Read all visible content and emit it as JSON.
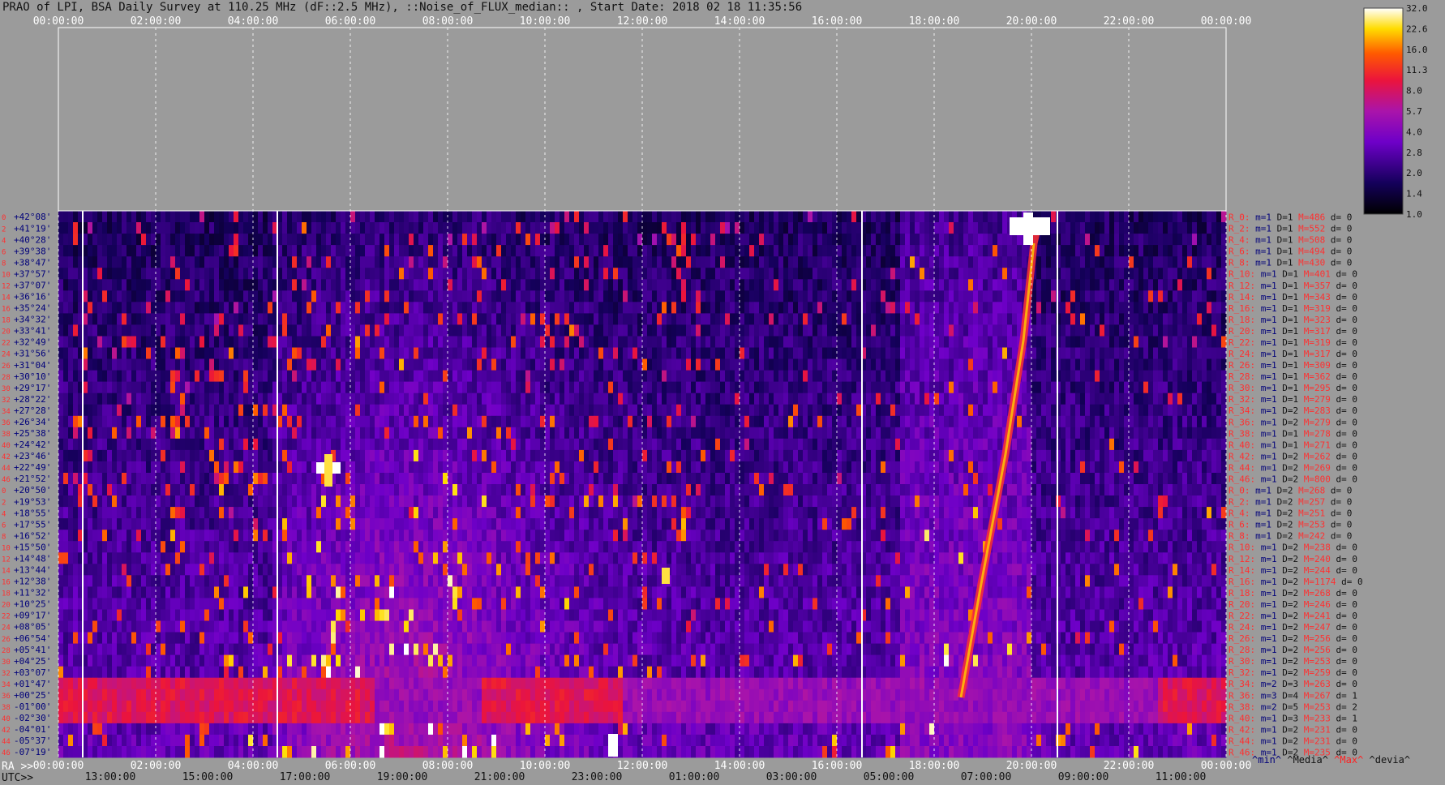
{
  "title": "PRAO of LPI, BSA Daily Survey at 110.25 MHz (dF::2.5 MHz), ::Noise_of_FLUX_median:: , Start Date: 2018 02 18 11:35:56",
  "axis_labels": {
    "ra": "RA >>",
    "utc": "UTC>>"
  },
  "legend_bottom": {
    "min": "^min^",
    "median": "^Media^",
    "max": "^Max^",
    "devia": "^devia^"
  },
  "colors": {
    "background": "#9b9b9b",
    "min": "#00007a",
    "median": "#111111",
    "max": "#ff2020",
    "devia": "#111111"
  },
  "chart_data": {
    "type": "heatmap",
    "colormap": "gnuplot-like (black-purple-red-yellow-white)",
    "top_time_ticks": [
      "00:00:00",
      "02:00:00",
      "04:00:00",
      "06:00:00",
      "08:00:00",
      "10:00:00",
      "12:00:00",
      "14:00:00",
      "16:00:00",
      "18:00:00",
      "20:00:00",
      "22:00:00",
      "00:00:00"
    ],
    "ra_ticks": [
      "00:00:00",
      "02:00:00",
      "04:00:00",
      "06:00:00",
      "08:00:00",
      "10:00:00",
      "12:00:00",
      "14:00:00",
      "16:00:00",
      "18:00:00",
      "20:00:00",
      "22:00:00",
      "00:00:00"
    ],
    "utc_ticks": [
      "13:00:00",
      "15:00:00",
      "17:00:00",
      "19:00:00",
      "21:00:00",
      "23:00:00",
      "01:00:00",
      "03:00:00",
      "05:00:00",
      "07:00:00",
      "09:00:00",
      "11:00:00"
    ],
    "colorbar_ticks": [
      "32.0",
      "22.6",
      "16.0",
      "11.3",
      "8.0",
      "5.7",
      "4.0",
      "2.8",
      "2.0",
      "1.4",
      "1.0"
    ],
    "declinations": [
      "+42°08'",
      "+41°19'",
      "+40°28'",
      "+39°38'",
      "+38°47'",
      "+37°57'",
      "+37°07'",
      "+36°16'",
      "+35°24'",
      "+34°32'",
      "+33°41'",
      "+32°49'",
      "+31°56'",
      "+31°04'",
      "+30°10'",
      "+29°17'",
      "+28°22'",
      "+27°28'",
      "+26°34'",
      "+25°38'",
      "+24°42'",
      "+23°46'",
      "+22°49'",
      "+21°52'",
      "+20°50'",
      "+19°53'",
      "+18°55'",
      "+17°55'",
      "+16°52'",
      "+15°50'",
      "+14°48'",
      "+13°44'",
      "+12°38'",
      "+11°32'",
      "+10°25'",
      "+09°17'",
      "+08°05'",
      "+06°54'",
      "+05°41'",
      "+04°25'",
      "+03°07'",
      "+01°47'",
      "+00°25'",
      "-01°00'",
      "-02°30'",
      "-04°01'",
      "-05°37'",
      "-07°19'"
    ],
    "row_numbers_left": [
      "0",
      "2",
      "4",
      "6",
      "8",
      "10",
      "12",
      "14",
      "16",
      "18",
      "20",
      "22",
      "24",
      "26",
      "28",
      "30",
      "32",
      "34",
      "36",
      "38",
      "40",
      "42",
      "44",
      "46",
      "0",
      "2",
      "4",
      "6",
      "8",
      "10",
      "12",
      "14",
      "16",
      "18",
      "20",
      "22",
      "24",
      "26",
      "28",
      "30",
      "32",
      "34",
      "36",
      "38",
      "40",
      "42",
      "44",
      "46"
    ],
    "rows": [
      {
        "r": "R_0:",
        "m": "m=1",
        "D": "D=1",
        "M": "M=486",
        "d": "d= 0"
      },
      {
        "r": "R_2:",
        "m": "m=1",
        "D": "D=1",
        "M": "M=552",
        "d": "d= 0"
      },
      {
        "r": "R_4:",
        "m": "m=1",
        "D": "D=1",
        "M": "M=508",
        "d": "d= 0"
      },
      {
        "r": "R_6:",
        "m": "m=1",
        "D": "D=1",
        "M": "M=494",
        "d": "d= 0"
      },
      {
        "r": "R_8:",
        "m": "m=1",
        "D": "D=1",
        "M": "M=430",
        "d": "d= 0"
      },
      {
        "r": "R_10:",
        "m": "m=1",
        "D": "D=1",
        "M": "M=401",
        "d": "d= 0"
      },
      {
        "r": "R_12:",
        "m": "m=1",
        "D": "D=1",
        "M": "M=357",
        "d": "d= 0"
      },
      {
        "r": "R_14:",
        "m": "m=1",
        "D": "D=1",
        "M": "M=343",
        "d": "d= 0"
      },
      {
        "r": "R_16:",
        "m": "m=1",
        "D": "D=1",
        "M": "M=319",
        "d": "d= 0"
      },
      {
        "r": "R_18:",
        "m": "m=1",
        "D": "D=1",
        "M": "M=323",
        "d": "d= 0"
      },
      {
        "r": "R_20:",
        "m": "m=1",
        "D": "D=1",
        "M": "M=317",
        "d": "d= 0"
      },
      {
        "r": "R_22:",
        "m": "m=1",
        "D": "D=1",
        "M": "M=319",
        "d": "d= 0"
      },
      {
        "r": "R_24:",
        "m": "m=1",
        "D": "D=1",
        "M": "M=317",
        "d": "d= 0"
      },
      {
        "r": "R_26:",
        "m": "m=1",
        "D": "D=1",
        "M": "M=309",
        "d": "d= 0"
      },
      {
        "r": "R_28:",
        "m": "m=1",
        "D": "D=1",
        "M": "M=362",
        "d": "d= 0"
      },
      {
        "r": "R_30:",
        "m": "m=1",
        "D": "D=1",
        "M": "M=295",
        "d": "d= 0"
      },
      {
        "r": "R_32:",
        "m": "m=1",
        "D": "D=1",
        "M": "M=279",
        "d": "d= 0"
      },
      {
        "r": "R_34:",
        "m": "m=1",
        "D": "D=2",
        "M": "M=283",
        "d": "d= 0"
      },
      {
        "r": "R_36:",
        "m": "m=1",
        "D": "D=2",
        "M": "M=279",
        "d": "d= 0"
      },
      {
        "r": "R_38:",
        "m": "m=1",
        "D": "D=1",
        "M": "M=278",
        "d": "d= 0"
      },
      {
        "r": "R_40:",
        "m": "m=1",
        "D": "D=1",
        "M": "M=271",
        "d": "d= 0"
      },
      {
        "r": "R_42:",
        "m": "m=1",
        "D": "D=2",
        "M": "M=262",
        "d": "d= 0"
      },
      {
        "r": "R_44:",
        "m": "m=1",
        "D": "D=2",
        "M": "M=269",
        "d": "d= 0"
      },
      {
        "r": "R_46:",
        "m": "m=1",
        "D": "D=2",
        "M": "M=800",
        "d": "d= 0"
      },
      {
        "r": "R_0:",
        "m": "m=1",
        "D": "D=2",
        "M": "M=268",
        "d": "d= 0"
      },
      {
        "r": "R_2:",
        "m": "m=1",
        "D": "D=2",
        "M": "M=257",
        "d": "d= 0"
      },
      {
        "r": "R_4:",
        "m": "m=1",
        "D": "D=2",
        "M": "M=251",
        "d": "d= 0"
      },
      {
        "r": "R_6:",
        "m": "m=1",
        "D": "D=2",
        "M": "M=253",
        "d": "d= 0"
      },
      {
        "r": "R_8:",
        "m": "m=1",
        "D": "D=2",
        "M": "M=242",
        "d": "d= 0"
      },
      {
        "r": "R_10:",
        "m": "m=1",
        "D": "D=2",
        "M": "M=238",
        "d": "d= 0"
      },
      {
        "r": "R_12:",
        "m": "m=1",
        "D": "D=2",
        "M": "M=240",
        "d": "d= 0"
      },
      {
        "r": "R_14:",
        "m": "m=1",
        "D": "D=2",
        "M": "M=244",
        "d": "d= 0"
      },
      {
        "r": "R_16:",
        "m": "m=1",
        "D": "D=2",
        "M": "M=1174",
        "d": "d= 0"
      },
      {
        "r": "R_18:",
        "m": "m=1",
        "D": "D=2",
        "M": "M=268",
        "d": "d= 0"
      },
      {
        "r": "R_20:",
        "m": "m=1",
        "D": "D=2",
        "M": "M=246",
        "d": "d= 0"
      },
      {
        "r": "R_22:",
        "m": "m=1",
        "D": "D=2",
        "M": "M=241",
        "d": "d= 0"
      },
      {
        "r": "R_24:",
        "m": "m=1",
        "D": "D=2",
        "M": "M=247",
        "d": "d= 0"
      },
      {
        "r": "R_26:",
        "m": "m=1",
        "D": "D=2",
        "M": "M=256",
        "d": "d= 0"
      },
      {
        "r": "R_28:",
        "m": "m=1",
        "D": "D=2",
        "M": "M=256",
        "d": "d= 0"
      },
      {
        "r": "R_30:",
        "m": "m=1",
        "D": "D=2",
        "M": "M=253",
        "d": "d= 0"
      },
      {
        "r": "R_32:",
        "m": "m=1",
        "D": "D=2",
        "M": "M=259",
        "d": "d= 0"
      },
      {
        "r": "R_34:",
        "m": "m=2",
        "D": "D=3",
        "M": "M=263",
        "d": "d= 0"
      },
      {
        "r": "R_36:",
        "m": "m=3",
        "D": "D=4",
        "M": "M=267",
        "d": "d= 1"
      },
      {
        "r": "R_38:",
        "m": "m=2",
        "D": "D=5",
        "M": "M=253",
        "d": "d= 2"
      },
      {
        "r": "R_40:",
        "m": "m=1",
        "D": "D=3",
        "M": "M=233",
        "d": "d= 1"
      },
      {
        "r": "R_42:",
        "m": "m=1",
        "D": "D=2",
        "M": "M=231",
        "d": "d= 0"
      },
      {
        "r": "R_44:",
        "m": "m=1",
        "D": "D=2",
        "M": "M=231",
        "d": "d= 0"
      },
      {
        "r": "R_46:",
        "m": "m=1",
        "D": "D=2",
        "M": "M=235",
        "d": "d= 0"
      }
    ]
  }
}
